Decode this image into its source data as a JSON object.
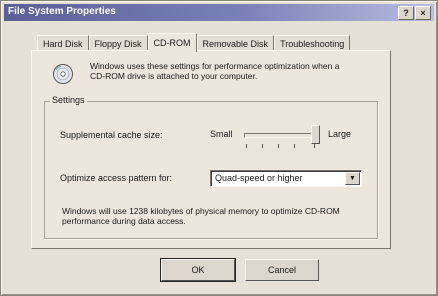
{
  "window": {
    "title": "File System Properties",
    "help_glyph": "?",
    "close_glyph": "×"
  },
  "tabs": [
    {
      "label": "Hard Disk",
      "active": false
    },
    {
      "label": "Floppy Disk",
      "active": false
    },
    {
      "label": "CD-ROM",
      "active": true
    },
    {
      "label": "Removable Disk",
      "active": false
    },
    {
      "label": "Troubleshooting",
      "active": false
    }
  ],
  "cdrom": {
    "intro_text": "Windows uses these settings for performance optimization when a CD-ROM drive is attached to your computer.",
    "settings_label": "Settings",
    "cache_label": "Supplemental cache size:",
    "cache_small": "Small",
    "cache_large": "Large",
    "cache_level": 1.0,
    "pattern_label": "Optimize access pattern for:",
    "pattern_value": "Quad-speed or higher",
    "memory_note": "Windows will use 1238 kilobytes of physical memory to optimize CD-ROM performance during data access."
  },
  "buttons": {
    "ok": "OK",
    "cancel": "Cancel"
  }
}
